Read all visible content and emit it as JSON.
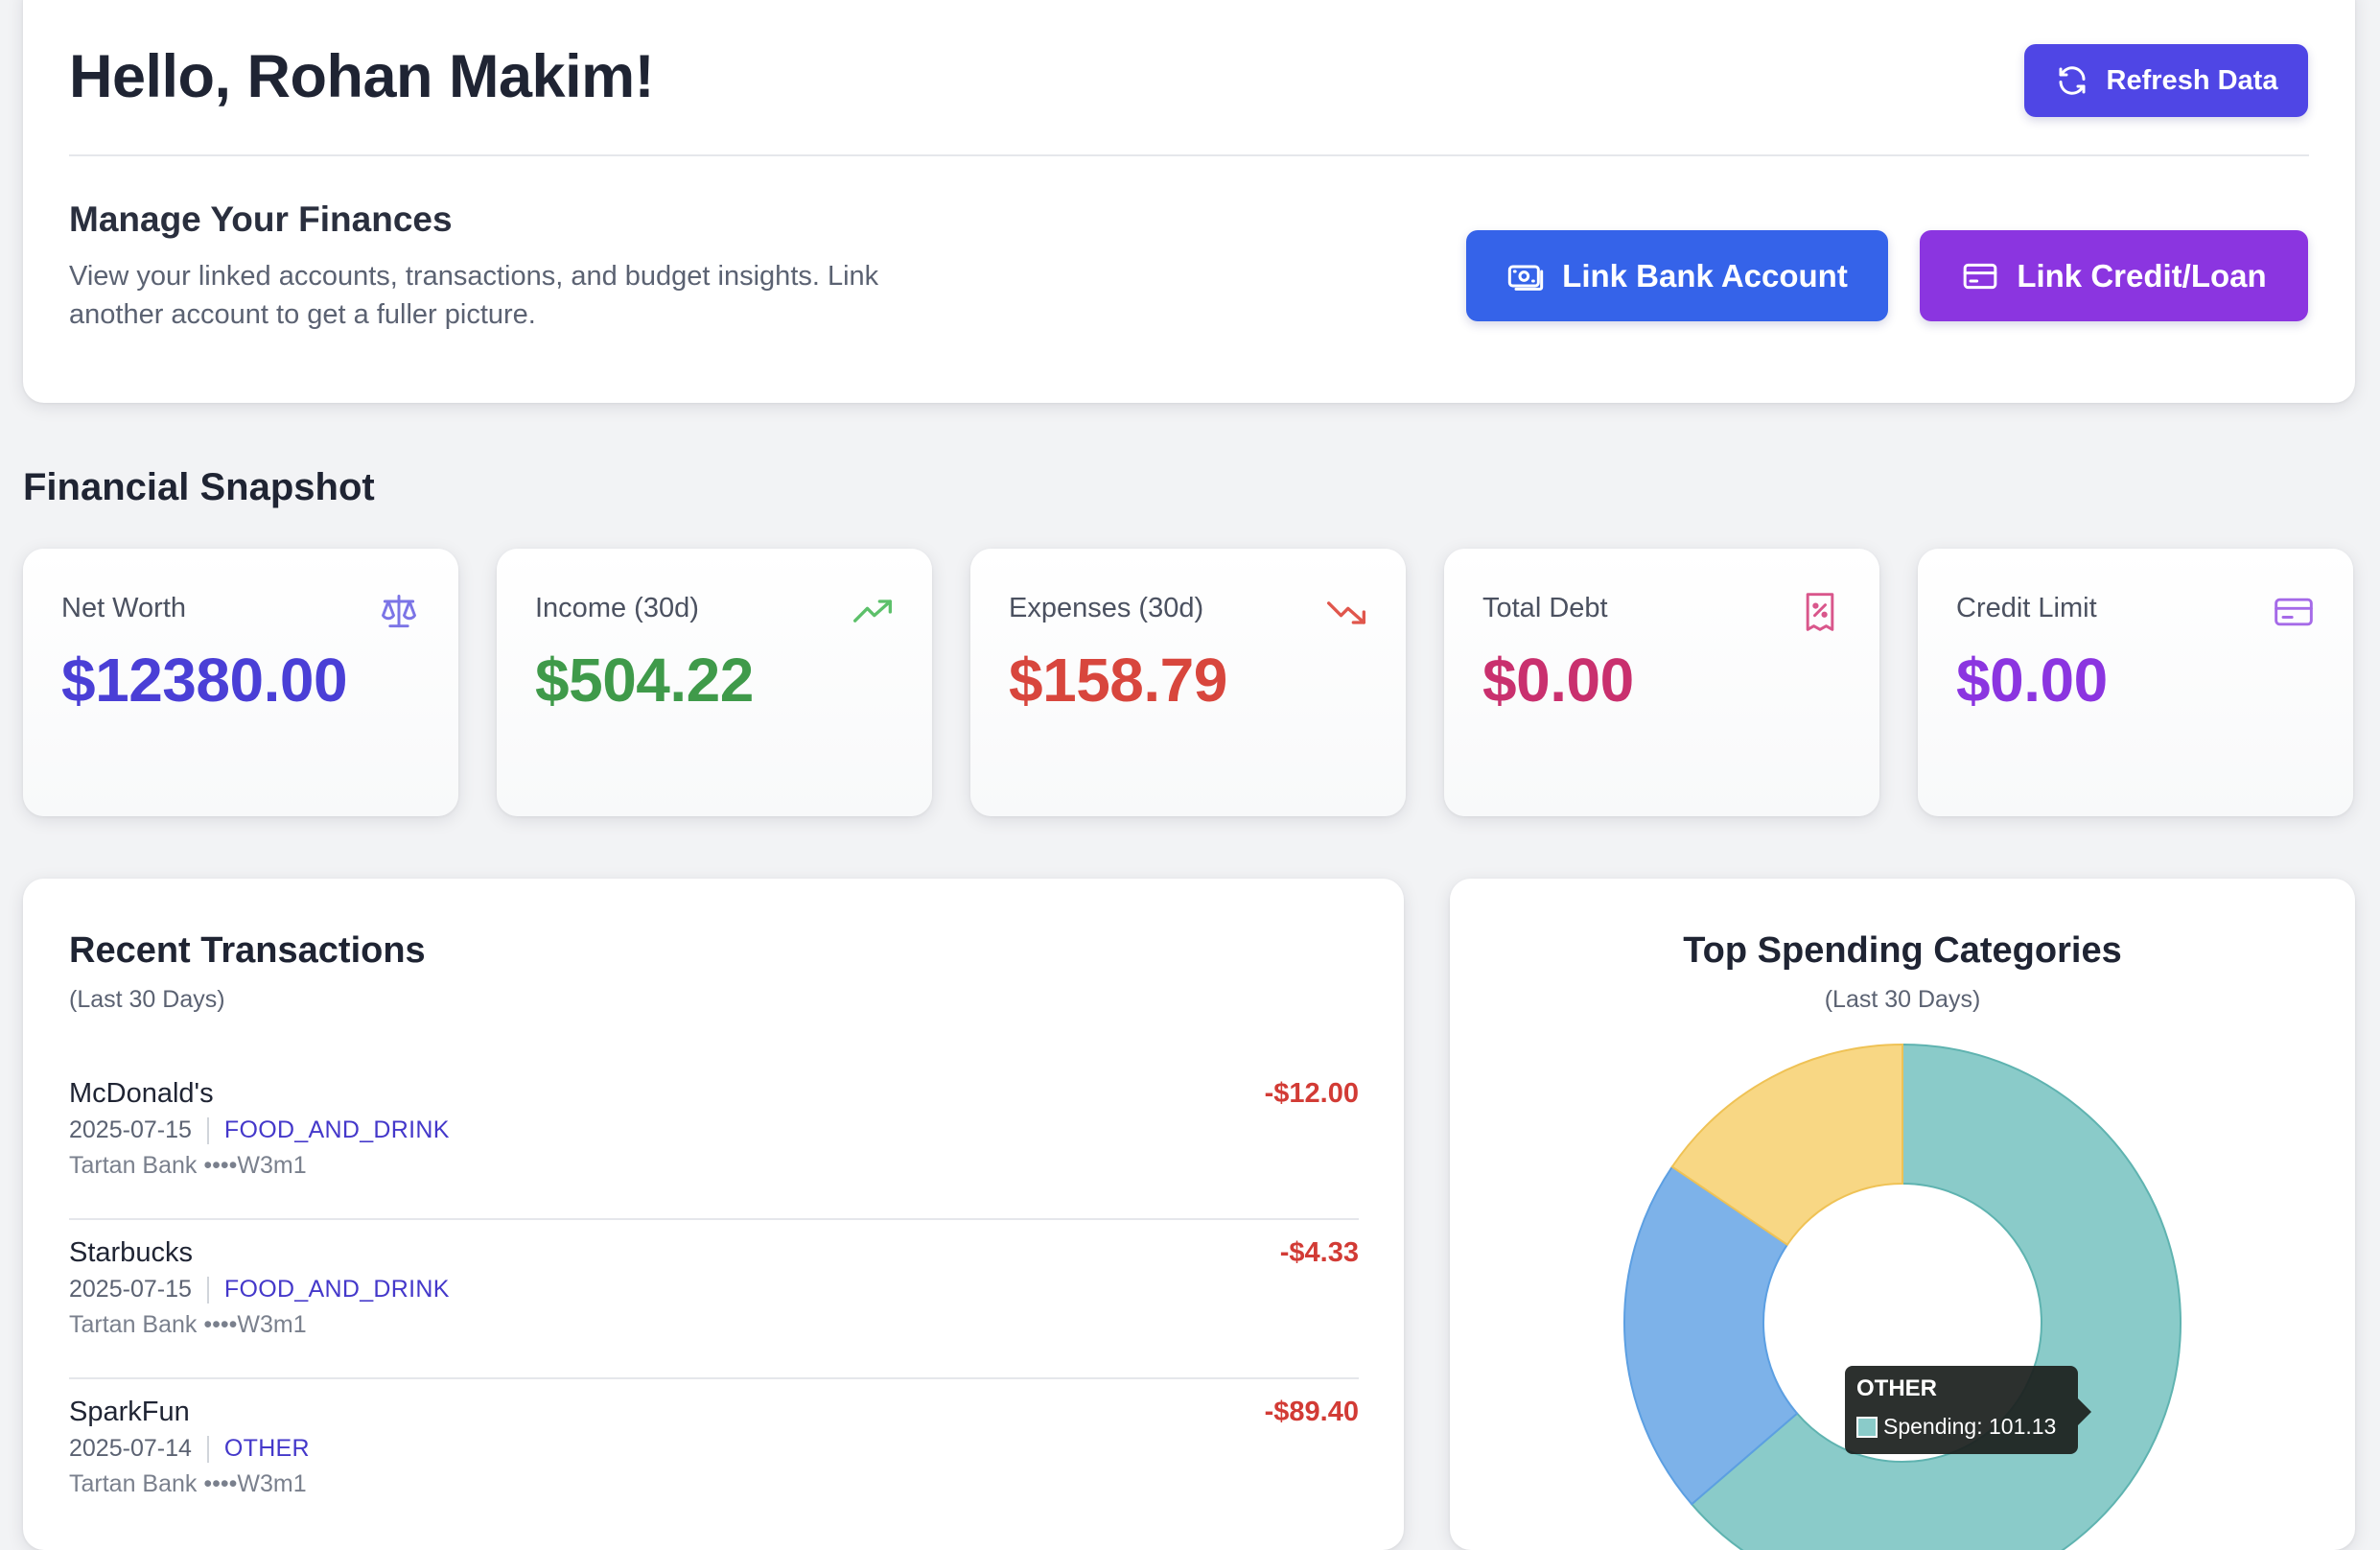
{
  "header": {
    "greeting": "Hello, Rohan Makim!",
    "refresh_label": "Refresh Data",
    "manage_title": "Manage Your Finances",
    "manage_description": "View your linked accounts, transactions, and budget insights. Link another account to get a fuller picture.",
    "link_bank_label": "Link Bank Account",
    "link_credit_label": "Link Credit/Loan"
  },
  "snapshot": {
    "title": "Financial Snapshot",
    "cards": [
      {
        "label": "Net Worth",
        "value": "$12380.00",
        "color": "#4a3fd6",
        "icon": "scale-icon",
        "icon_color": "#7b74e6"
      },
      {
        "label": "Income (30d)",
        "value": "$504.22",
        "color": "#3f9a4a",
        "icon": "trending-up-icon",
        "icon_color": "#5cc06a"
      },
      {
        "label": "Expenses (30d)",
        "value": "$158.79",
        "color": "#d8463d",
        "icon": "trending-down-icon",
        "icon_color": "#e0564c"
      },
      {
        "label": "Total Debt",
        "value": "$0.00",
        "color": "#c9306e",
        "icon": "receipt-percent-icon",
        "icon_color": "#d9568b"
      },
      {
        "label": "Credit Limit",
        "value": "$0.00",
        "color": "#8b35e0",
        "icon": "credit-card-icon",
        "icon_color": "#a56ae8"
      }
    ]
  },
  "transactions": {
    "title": "Recent Transactions",
    "subtitle": "(Last 30 Days)",
    "items": [
      {
        "name": "McDonald's",
        "date": "2025-07-15",
        "category": "FOOD_AND_DRINK",
        "account": "Tartan Bank ••••W3m1",
        "amount": "-$12.00"
      },
      {
        "name": "Starbucks",
        "date": "2025-07-15",
        "category": "FOOD_AND_DRINK",
        "account": "Tartan Bank ••••W3m1",
        "amount": "-$4.33"
      },
      {
        "name": "SparkFun",
        "date": "2025-07-14",
        "category": "OTHER",
        "account": "Tartan Bank ••••W3m1",
        "amount": "-$89.40"
      }
    ]
  },
  "spending": {
    "title": "Top Spending Categories",
    "subtitle": "(Last 30 Days)",
    "tooltip": {
      "title": "OTHER",
      "text": "Spending: 101.13"
    }
  },
  "chart_data": {
    "type": "pie",
    "title": "Top Spending Categories",
    "subtitle": "(Last 30 Days)",
    "series": [
      {
        "value": 101.13,
        "color": "#8acbc9",
        "border": "#5fb3b0"
      },
      {
        "value": 33.0,
        "color": "#7db2e9",
        "border": "#5c9fe2"
      },
      {
        "value": 24.66,
        "color": "#f8d784",
        "border": "#efc255"
      }
    ],
    "donut": true
  }
}
